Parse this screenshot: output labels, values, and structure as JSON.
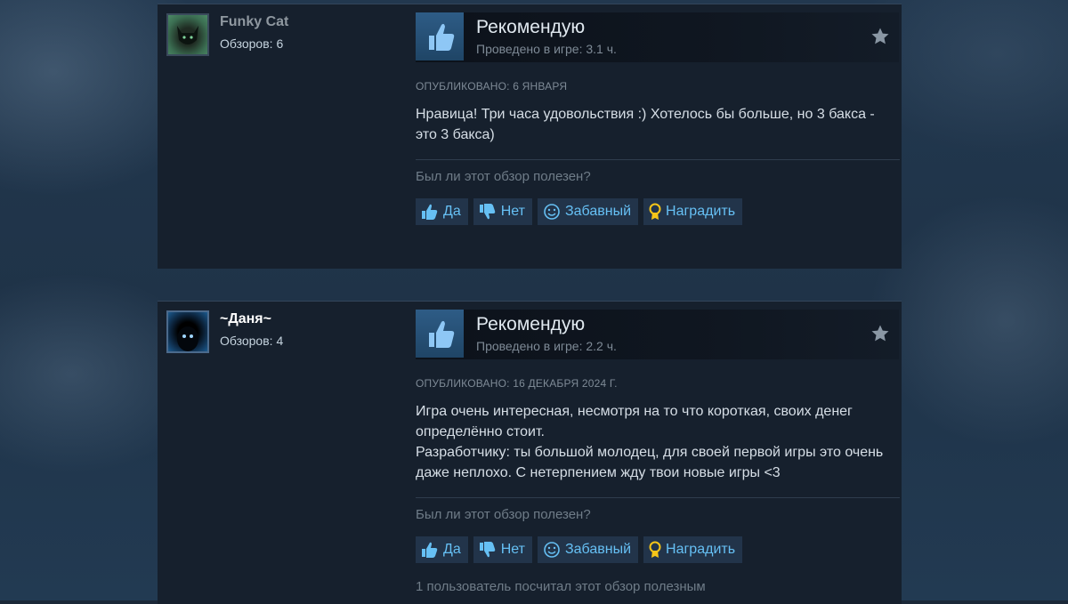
{
  "colors": {
    "page_bg": "#1b2838",
    "card_bg": "#16202d",
    "link_blue": "#66c0f4",
    "thumb_box": "#2e5c86"
  },
  "reviews": [
    {
      "author": "Funky Cat",
      "review_count": "Обзоров: 6",
      "avatar_icon": "black-cat-avatar",
      "verdict": "Рекомендую",
      "playtime": "Проведено в игре: 3.1 ч.",
      "posted": "ОПУБЛИКОВАНО: 6 ЯНВАРЯ",
      "body": [
        "Нравица! Три часа удовольствия :) Хотелось бы больше, но 3 бакса - это 3 бакса)"
      ],
      "helpful_question": "Был ли этот обзор полезен?",
      "buttons": {
        "yes": "Да",
        "no": "Нет",
        "funny": "Забавный",
        "award": "Наградить"
      }
    },
    {
      "author": "~Даня~",
      "review_count": "Обзоров: 4",
      "avatar_icon": "dark-glow-avatar",
      "verdict": "Рекомендую",
      "playtime": "Проведено в игре: 2.2 ч.",
      "posted": "ОПУБЛИКОВАНО: 16 ДЕКАБРЯ 2024 Г.",
      "body": [
        "Игра очень интересная, несмотря на то что короткая, своих денег определённо стоит.",
        "Разработчику: ты большой молодец, для своей первой игры это очень даже неплохо. С нетерпением жду твои новые игры <3"
      ],
      "helpful_question": "Был ли этот обзор полезен?",
      "buttons": {
        "yes": "Да",
        "no": "Нет",
        "funny": "Забавный",
        "award": "Наградить"
      },
      "helpful_summary": "1 пользователь посчитал этот обзор полезным"
    }
  ]
}
